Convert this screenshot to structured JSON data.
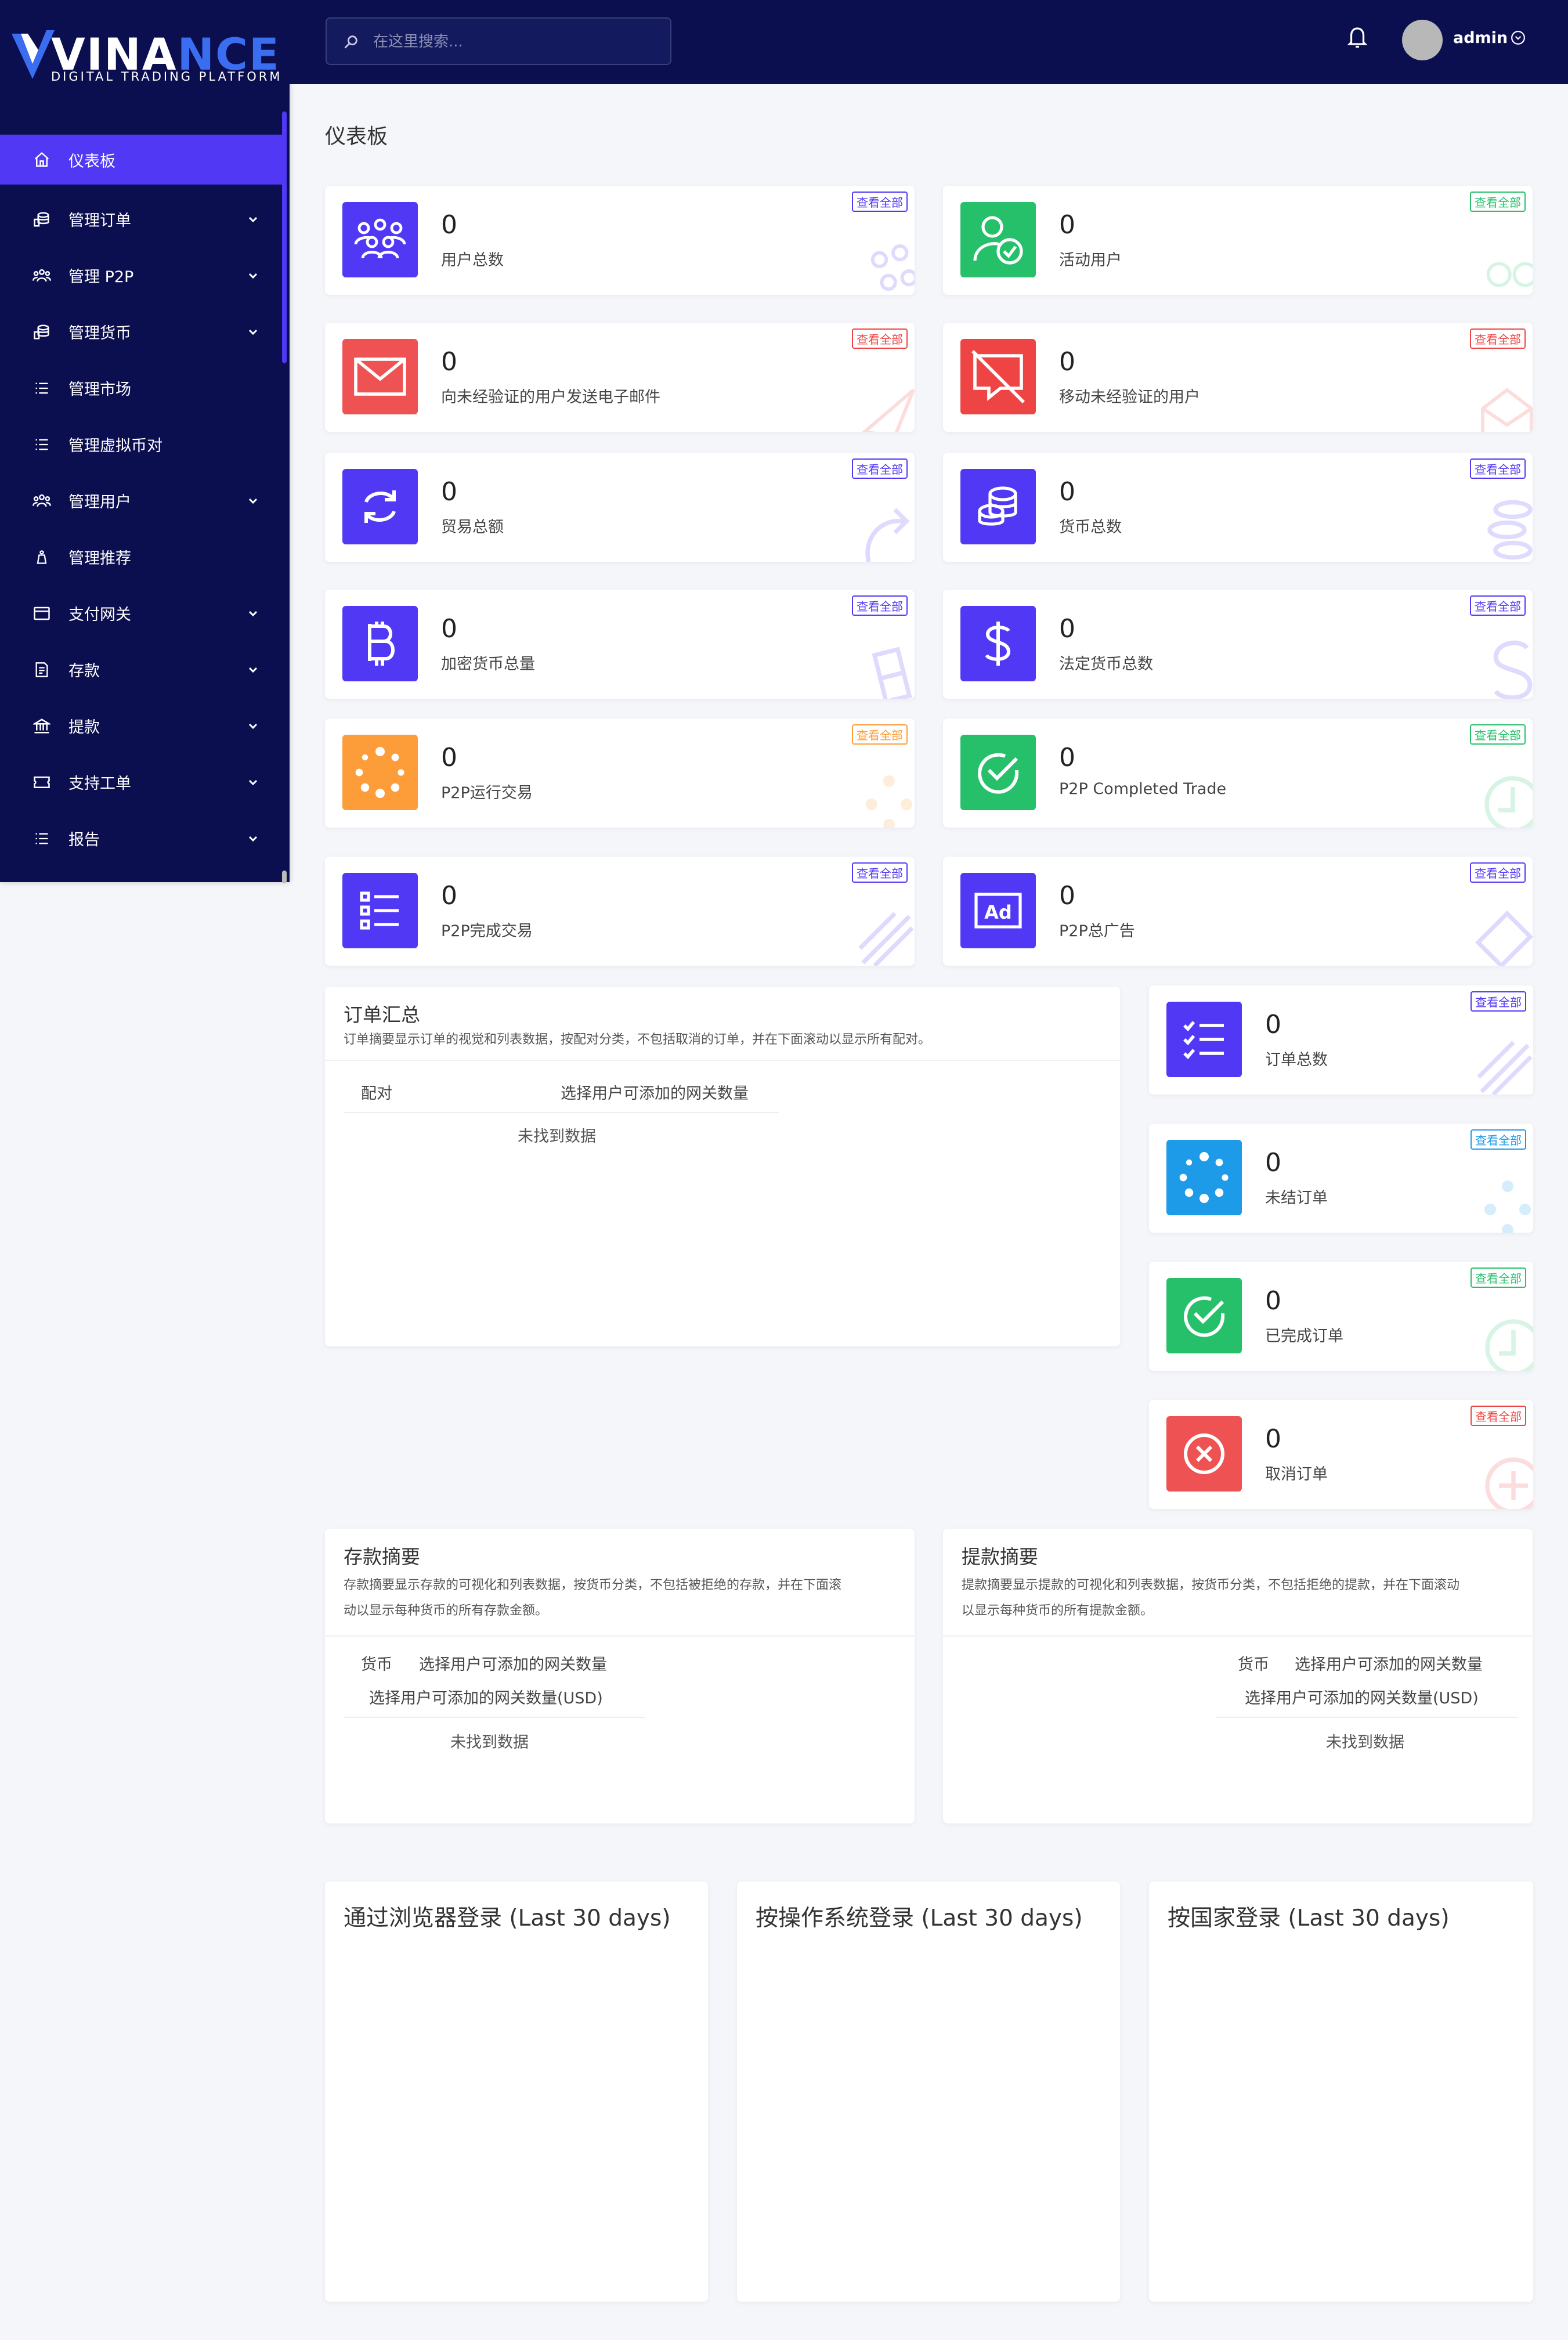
{
  "brand": {
    "name_prefix": "VINA",
    "name_accent": "NCE",
    "tagline": "DIGITAL TRADING PLATFORM"
  },
  "search": {
    "placeholder": "在这里搜索..."
  },
  "user": {
    "name": "admin"
  },
  "page": {
    "title": "仪表板"
  },
  "sidebar": {
    "items": [
      {
        "label": "仪表板",
        "icon": "home-icon",
        "active": true,
        "has_submenu": false
      },
      {
        "label": "管理订单",
        "icon": "coins-icon",
        "has_submenu": true
      },
      {
        "label": "管理 P2P",
        "icon": "users-icon",
        "has_submenu": true
      },
      {
        "label": "管理货币",
        "icon": "coins-icon",
        "has_submenu": true
      },
      {
        "label": "管理市场",
        "icon": "list-icon",
        "has_submenu": false
      },
      {
        "label": "管理虚拟币对",
        "icon": "list-icon",
        "has_submenu": false
      },
      {
        "label": "管理用户",
        "icon": "users-icon",
        "has_submenu": true
      },
      {
        "label": "管理推荐",
        "icon": "gift-icon",
        "has_submenu": false
      },
      {
        "label": "支付网关",
        "icon": "card-icon",
        "has_submenu": true
      },
      {
        "label": "存款",
        "icon": "receipt-icon",
        "has_submenu": true
      },
      {
        "label": "提款",
        "icon": "bank-icon",
        "has_submenu": true
      },
      {
        "label": "支持工单",
        "icon": "ticket-icon",
        "has_submenu": true
      },
      {
        "label": "报告",
        "icon": "list-icon",
        "has_submenu": true
      }
    ]
  },
  "stats": {
    "view_all": "查看全部",
    "total_users": {
      "value": "0",
      "label": "用户总数"
    },
    "active_users": {
      "value": "0",
      "label": "活动用户"
    },
    "email_unverified": {
      "value": "0",
      "label": "向未经验证的用户发送电子邮件"
    },
    "mobile_unverified": {
      "value": "0",
      "label": "移动未经验证的用户"
    },
    "total_trades": {
      "value": "0",
      "label": "贸易总额"
    },
    "total_currencies": {
      "value": "0",
      "label": "货币总数"
    },
    "crypto_total": {
      "value": "0",
      "label": "加密货币总量"
    },
    "fiat_total": {
      "value": "0",
      "label": "法定货币总数"
    },
    "p2p_running": {
      "value": "0",
      "label": "P2P运行交易"
    },
    "p2p_completed_en": {
      "value": "0",
      "label": "P2P Completed Trade"
    },
    "p2p_completed": {
      "value": "0",
      "label": "P2P完成交易"
    },
    "p2p_ads": {
      "value": "0",
      "label": "P2P总广告"
    },
    "orders_total": {
      "value": "0",
      "label": "订单总数"
    },
    "orders_open": {
      "value": "0",
      "label": "未结订单"
    },
    "orders_done": {
      "value": "0",
      "label": "已完成订单"
    },
    "orders_cancelled": {
      "value": "0",
      "label": "取消订单"
    }
  },
  "order_summary": {
    "title": "订单汇总",
    "desc": "订单摘要显示订单的视觉和列表数据，按配对分类，不包括取消的订单，并在下面滚动以显示所有配对。",
    "col_pair": "配对",
    "col_amount": "选择用户可添加的网关数量",
    "empty": "未找到数据"
  },
  "deposit_summary": {
    "title": "存款摘要",
    "desc_line1": "存款摘要显示存款的可视化和列表数据，按货币分类，不包括被拒绝的存款，并在下面滚",
    "desc_line2": "动以显示每种货币的所有存款金额。",
    "col_currency": "货币",
    "col_amount": "选择用户可添加的网关数量",
    "col_usd": "选择用户可添加的网关数量(USD)",
    "empty": "未找到数据"
  },
  "withdraw_summary": {
    "title": "提款摘要",
    "desc_line1": "提款摘要显示提款的可视化和列表数据，按货币分类，不包括拒绝的提款，并在下面滚动",
    "desc_line2": "以显示每种货币的所有提款金额。",
    "col_currency": "货币",
    "col_amount": "选择用户可添加的网关数量",
    "col_usd": "选择用户可添加的网关数量(USD)",
    "empty": "未找到数据"
  },
  "charts": {
    "browser": "通过浏览器登录 (Last 30 days)",
    "os": "按操作系统登录 (Last 30 days)",
    "country": "按国家登录 (Last 30 days)"
  },
  "colors": {
    "sidebar_bg": "#0c0f4f",
    "accent": "#5038f5",
    "green": "#26c06b",
    "red": "#ee4444",
    "orange": "#fd9d3a",
    "blue": "#1e9be8"
  }
}
